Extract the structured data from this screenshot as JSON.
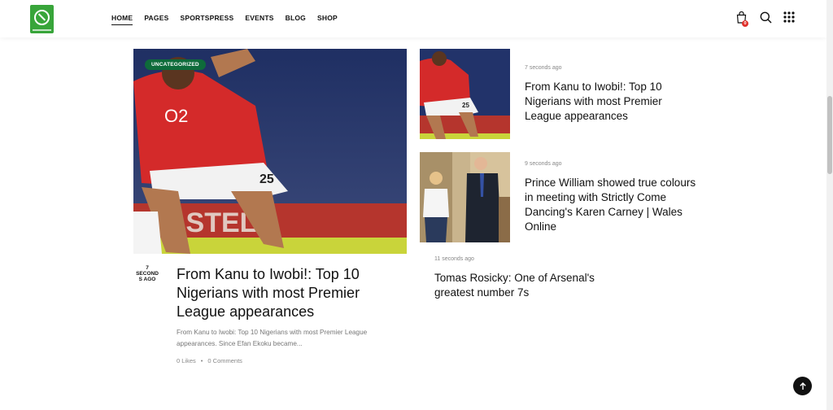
{
  "nav": {
    "items": [
      "HOME",
      "PAGES",
      "SPORTSPRESS",
      "EVENTS",
      "BLOG",
      "SHOP"
    ]
  },
  "header": {
    "cart_count": "0",
    "icons": [
      "shopping-bag-icon",
      "search-icon",
      "grid-menu-icon"
    ]
  },
  "featured": {
    "category": "UNCATEGORIZED",
    "date_lines": [
      "7",
      "SECOND",
      "S AGO"
    ],
    "title": "From Kanu to Iwobi!: Top 10 Nigerians with most Premier League appearances",
    "excerpt": "From Kanu to Iwobi: Top 10 Nigerians with most Premier League appearances. Since Efan Ekoku became...",
    "likes": "0 Likes",
    "separator": "•",
    "comments": "0 Comments"
  },
  "side_posts": [
    {
      "time": "7 seconds ago",
      "title": "From Kanu to Iwobi!: Top 10 Nigerians with most Premier League appearances"
    },
    {
      "time": "9 seconds ago",
      "title": "Prince William showed true colours in meeting with Strictly Come Dancing's Karen Carney | Wales Online"
    },
    {
      "time": "11 seconds ago",
      "title": "Tomas Rosicky: One of Arsenal's greatest number 7s"
    }
  ],
  "colors": {
    "accent_green": "#0e6b3a",
    "logo_green": "#38a53a",
    "badge_red": "#e0322c"
  }
}
